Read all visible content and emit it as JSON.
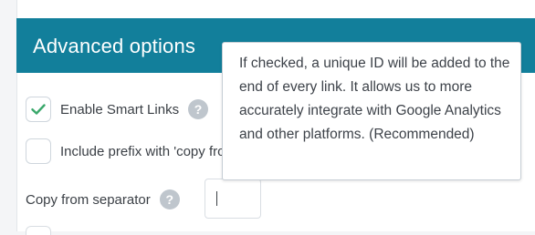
{
  "section": {
    "title": "Advanced options"
  },
  "options": {
    "enable_smart_links": {
      "label": "Enable Smart Links",
      "checked": true,
      "help_icon": "question-icon"
    },
    "include_prefix": {
      "label": "Include prefix with 'copy from' text",
      "checked": false
    },
    "copy_from_separator": {
      "label": "Copy from separator",
      "value": "",
      "help_icon": "question-icon"
    }
  },
  "tooltip": {
    "text": "If checked, a unique ID will be added to the end of every link. It allows us to more accurately integrate with Google Analytics and other platforms. (Recommended)"
  },
  "colors": {
    "header_bg": "#127f9b",
    "check_color": "#3aa86b",
    "help_icon_bg": "#bfc6cd"
  }
}
